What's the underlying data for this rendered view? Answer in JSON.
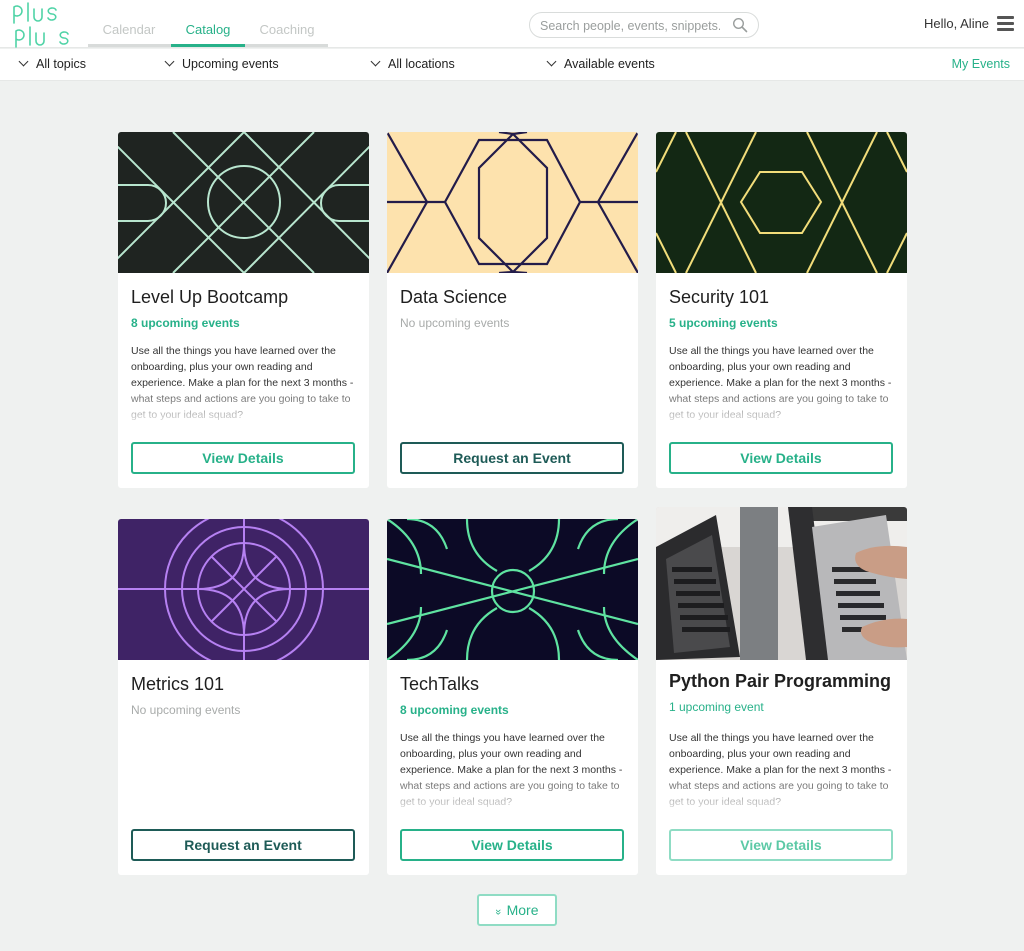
{
  "app": {
    "logo_text": "plus plus",
    "greeting": "Hello, Aline"
  },
  "nav": {
    "tabs": [
      {
        "label": "Calendar"
      },
      {
        "label": "Catalog"
      },
      {
        "label": "Coaching"
      }
    ],
    "active_tab": "Catalog"
  },
  "search": {
    "placeholder": "Search people, events, snippets...",
    "value": ""
  },
  "filters": {
    "topics": "All topics",
    "timeframe": "Upcoming events",
    "locations": "All locations",
    "availability": "Available events",
    "my_events": "My Events"
  },
  "cards": [
    {
      "title": "Level Up Bootcamp",
      "upcoming": "8 upcoming events",
      "description": "Use all the things you have learned over the onboarding, plus your own reading and experience. Make a plan for the next 3 months - what steps and actions are you going to take to get to your ideal squad?",
      "button": "View Details",
      "art_icon": "geometric-circle-pattern",
      "art_bg": "#1f2421",
      "art_line": "#b8e6cf"
    },
    {
      "title": "Data Science",
      "upcoming": "No upcoming events",
      "description": "",
      "button": "Request an Event",
      "art_icon": "geometric-cube-pattern",
      "art_bg": "#fde2ad",
      "art_line": "#231c4a"
    },
    {
      "title": "Security 101",
      "upcoming": "5 upcoming events",
      "description": "Use all the things you have learned over the onboarding, plus your own reading and experience. Make a plan for the next 3 months - what steps and actions are you going to take to get to your ideal squad?",
      "button": "View Details",
      "art_icon": "geometric-hexagon-pattern",
      "art_bg": "#132814",
      "art_line": "#f2dd7a"
    },
    {
      "title": "Metrics 101",
      "upcoming": "No upcoming events",
      "description": "",
      "button": "Request an Event",
      "art_icon": "geometric-star-pattern",
      "art_bg": "#3f2366",
      "art_line": "#b681f2"
    },
    {
      "title": "TechTalks",
      "upcoming": "8 upcoming events",
      "description": "Use all the things you have learned over the onboarding, plus your own reading and experience. Make a plan for the next 3 months - what steps and actions are you going to take to get to your ideal squad?",
      "button": "View Details",
      "art_icon": "geometric-wave-pattern",
      "art_bg": "#0c0a26",
      "art_line": "#5fe3a1"
    },
    {
      "title": "Python Pair Programming",
      "upcoming": "1 upcoming event",
      "description": "Use all the things you have learned over the onboarding, plus your own reading and experience. Make a plan for the next 3 months - what steps and actions are you going to take to get to your ideal squad?",
      "button": "View Details",
      "art_icon": "laptops-photo"
    }
  ],
  "more_button": "More",
  "colors": {
    "accent": "#27b189",
    "request": "#1e5b57",
    "background": "#eff1f0"
  }
}
